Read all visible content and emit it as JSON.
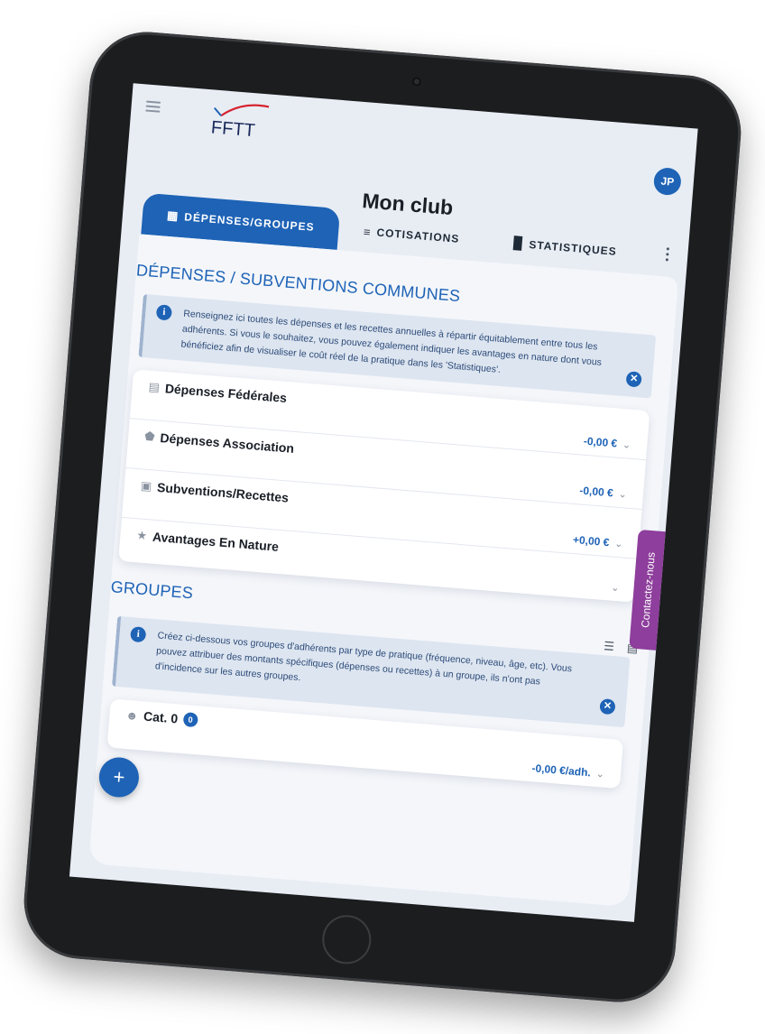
{
  "header": {
    "logo_text": "FFTT",
    "avatar_initials": "JP",
    "page_title": "Mon club"
  },
  "tabs": [
    {
      "label": "DÉPENSES/GROUPES",
      "icon": "calculator-icon",
      "active": true
    },
    {
      "label": "COTISATIONS",
      "icon": "sliders-icon",
      "active": false
    },
    {
      "label": "STATISTIQUES",
      "icon": "bar-chart-icon",
      "active": false
    }
  ],
  "depenses": {
    "title": "DÉPENSES / SUBVENTIONS COMMUNES",
    "info": "Renseignez ici toutes les dépenses et les recettes annuelles à répartir équitablement entre tous les adhérents. Si vous le souhaitez, vous pouvez également indiquer les avantages en nature dont vous bénéficiez afin de visualiser le coût réel de la pratique dans les 'Statistiques'.",
    "items": [
      {
        "label": "Dépenses Fédérales",
        "icon": "bank-icon",
        "value": "-0,00 €"
      },
      {
        "label": "Dépenses Association",
        "icon": "shield-icon",
        "value": "-0,00 €"
      },
      {
        "label": "Subventions/Recettes",
        "icon": "gift-icon",
        "value": "+0,00 €"
      },
      {
        "label": "Avantages En Nature",
        "icon": "star-icon",
        "value": ""
      }
    ]
  },
  "groupes": {
    "title": "GROUPES",
    "info": "Créez ci-dessous vos groupes d'adhérents par type de pratique (fréquence, niveau, âge, etc). Vous pouvez attribuer des montants spécifiques (dépenses ou recettes) à un groupe, ils n'ont pas d'incidence sur les autres groupes.",
    "group": {
      "label": "Cat. 0",
      "count": "0",
      "value": "-0,00 €/adh."
    }
  },
  "contact_label": "Contactez-nous",
  "colors": {
    "primary": "#1e63b6",
    "contact": "#8e3e9c"
  }
}
